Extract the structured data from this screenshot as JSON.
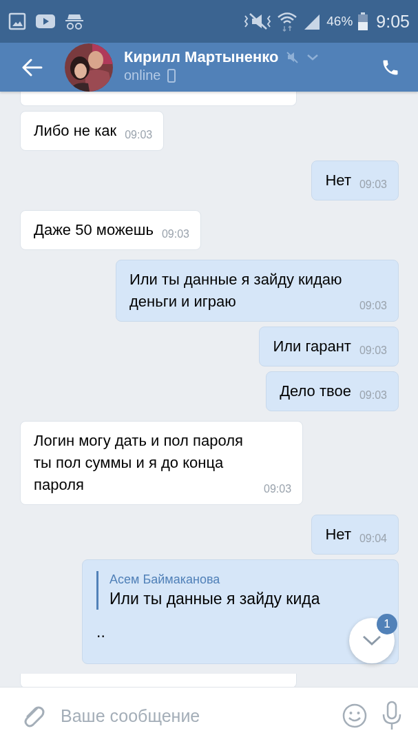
{
  "status_bar": {
    "battery": "46%",
    "time": "9:05"
  },
  "header": {
    "name": "Кирилл Мартыненко",
    "status": "online",
    "muted": true
  },
  "messages": [
    {
      "kind": "cut",
      "outgoing": false
    },
    {
      "kind": "text",
      "outgoing": false,
      "text": "Либо не как",
      "time": "09:03"
    },
    {
      "kind": "text",
      "outgoing": true,
      "text": "Нет",
      "time": "09:03"
    },
    {
      "kind": "text",
      "outgoing": false,
      "text": "Даже 50 можешь",
      "time": "09:03"
    },
    {
      "kind": "text",
      "outgoing": true,
      "text": "Или ты данные я зайду кидаю деньги и играю",
      "time": "09:03"
    },
    {
      "kind": "text",
      "outgoing": true,
      "text": "Или гарант",
      "time": "09:03"
    },
    {
      "kind": "text",
      "outgoing": true,
      "text": "Дело твое",
      "time": "09:03"
    },
    {
      "kind": "text",
      "outgoing": false,
      "text": "Логин могу дать и пол пароля ты пол суммы и я до конца пароля",
      "time": "09:03"
    },
    {
      "kind": "text",
      "outgoing": true,
      "text": "Нет",
      "time": "09:04"
    },
    {
      "kind": "reply",
      "outgoing": true,
      "quote_author": "Асем Баймаканова",
      "quote_text": "Или ты данные я зайду кида",
      "text": ".."
    },
    {
      "kind": "cut",
      "outgoing": false
    }
  ],
  "scroll_button": {
    "badge": "1"
  },
  "composer": {
    "placeholder": "Ваше сообщение"
  }
}
